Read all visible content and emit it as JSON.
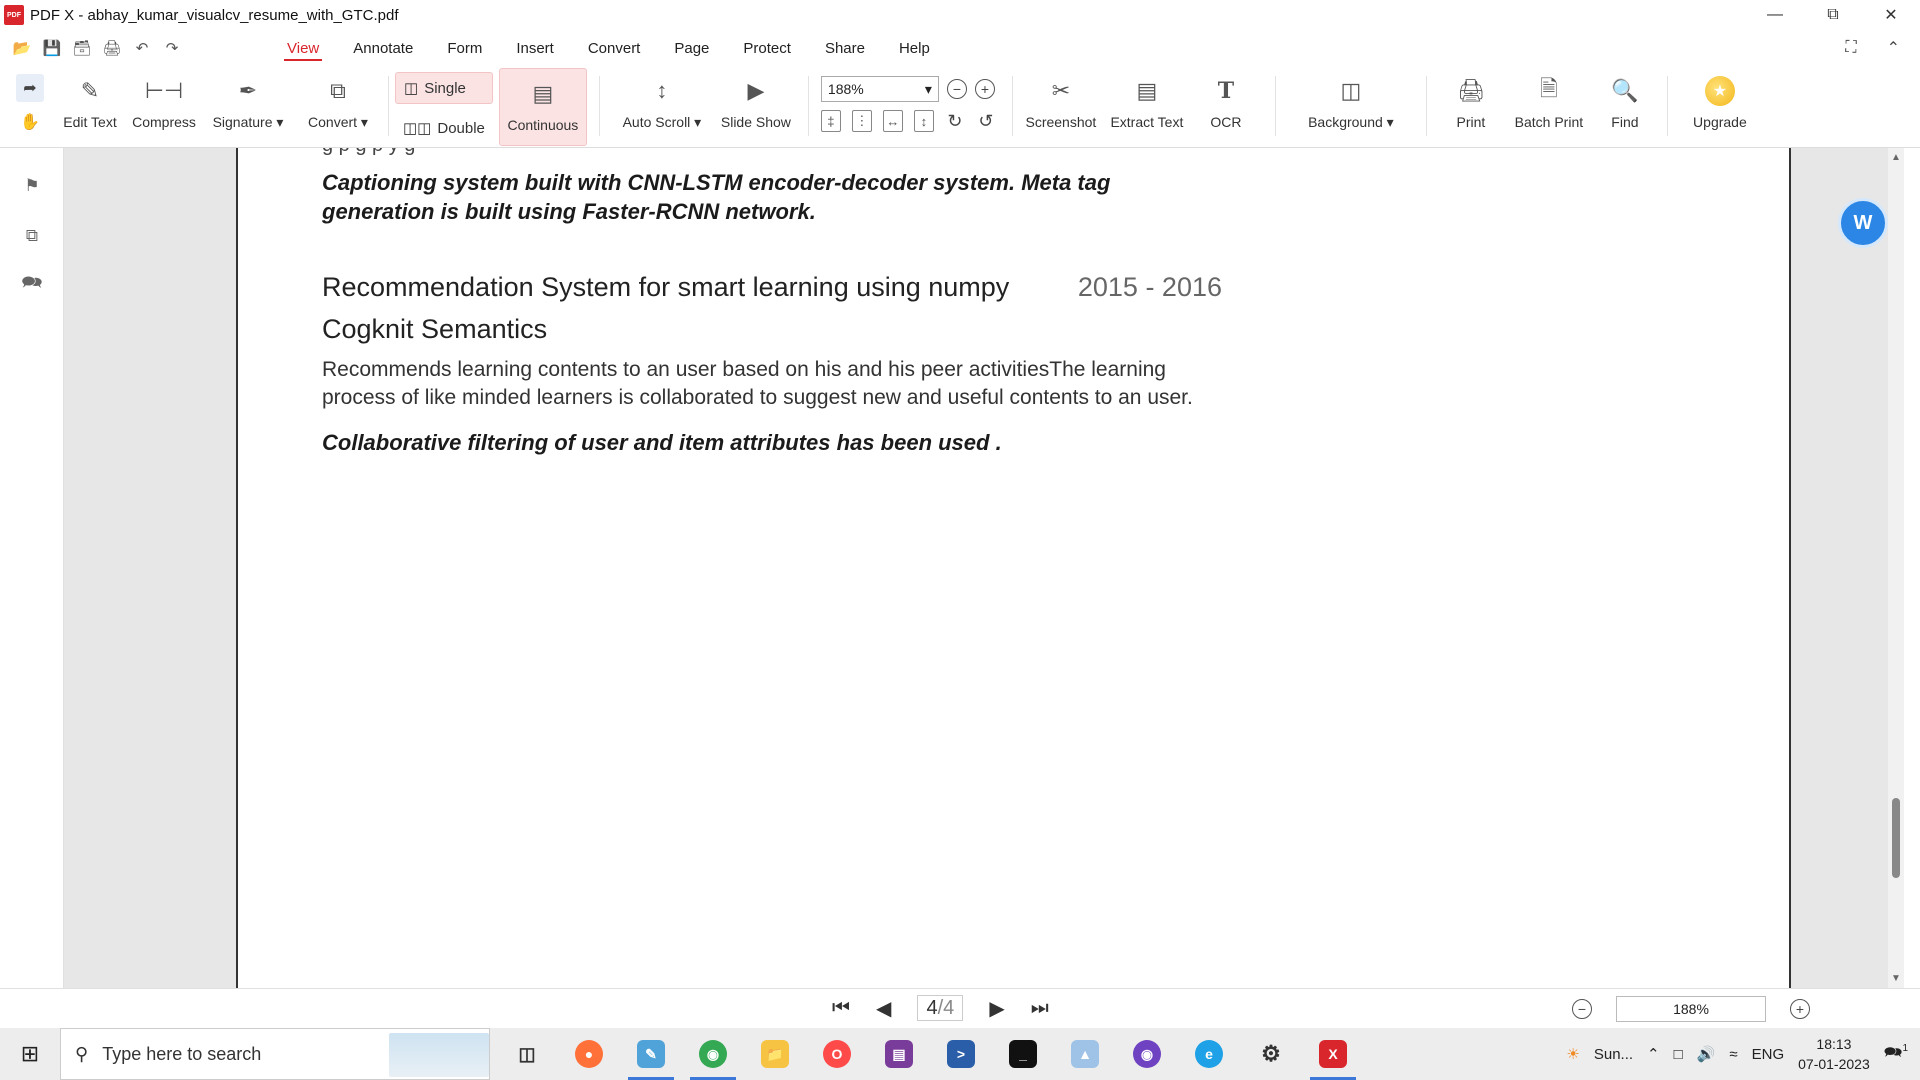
{
  "window": {
    "title": "PDF X - abhay_kumar_visualcv_resume_with_GTC.pdf",
    "app_icon_text": "PDF"
  },
  "menu": {
    "items": [
      "View",
      "Annotate",
      "Form",
      "Insert",
      "Convert",
      "Page",
      "Protect",
      "Share",
      "Help"
    ],
    "active": "View"
  },
  "ribbon": {
    "edit_text": "Edit Text",
    "compress": "Compress",
    "signature": "Signature",
    "convert": "Convert",
    "single": "Single",
    "double": "Double",
    "continuous": "Continuous",
    "auto_scroll": "Auto Scroll",
    "slide_show": "Slide Show",
    "zoom_value": "188%",
    "screenshot": "Screenshot",
    "extract_text": "Extract Text",
    "ocr": "OCR",
    "background": "Background",
    "print": "Print",
    "batch_print": "Batch Print",
    "find": "Find",
    "upgrade": "Upgrade"
  },
  "document": {
    "cut_line": "g   p   g p   y   g",
    "caption_bold": "Captioning system built with CNN-LSTM encoder-decoder system. Meta tag generation is built using Faster-RCNN network.",
    "project_title": "Recommendation System for smart learning using numpy",
    "project_years": "2015 - 2016",
    "company": "Cogknit Semantics",
    "description": "Recommends learning contents to an user based on his and his peer activitiesThe learning process of like minded learners is collaborated to suggest  new and useful contents to an user.",
    "closing_bold": "Collaborative filtering of user and item attributes has been used ."
  },
  "statusbar": {
    "page_current": "4",
    "page_total": "/4",
    "zoom": "188%"
  },
  "taskbar": {
    "search_placeholder": "Type here to search",
    "weather": "Sun...",
    "language": "ENG",
    "time": "18:13",
    "date": "07-01-2023",
    "notification_count": "1"
  },
  "colors": {
    "accent": "#d9262c",
    "active_bg": "#fbe3e4",
    "float_button": "#2b86e5"
  }
}
